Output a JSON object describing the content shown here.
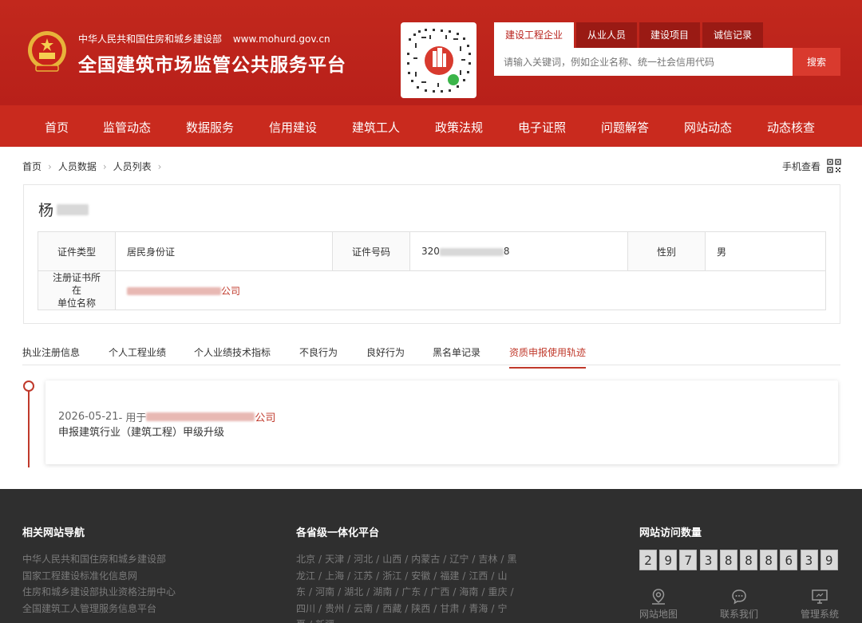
{
  "header": {
    "org": "中华人民共和国住房和城乡建设部",
    "url": "www.mohurd.gov.cn",
    "title": "全国建筑市场监管公共服务平台",
    "accent": "#b8201a"
  },
  "search": {
    "tabs": [
      "建设工程企业",
      "从业人员",
      "建设项目",
      "诚信记录"
    ],
    "active_tab": "建设工程企业",
    "placeholder": "请输入关键词，例如企业名称、统一社会信用代码",
    "button": "搜索"
  },
  "nav": [
    "首页",
    "监管动态",
    "数据服务",
    "信用建设",
    "建筑工人",
    "政策法规",
    "电子证照",
    "问题解答",
    "网站动态",
    "动态核查"
  ],
  "breadcrumb": [
    "首页",
    "人员数据",
    "人员列表"
  ],
  "mobile_view": "手机查看",
  "person": {
    "name_prefix": "杨",
    "id_type_label": "证件类型",
    "id_type": "居民身份证",
    "id_no_label": "证件号码",
    "id_no_prefix": "320",
    "id_no_suffix": "8",
    "gender_label": "性别",
    "gender": "男",
    "employer_label_1": "注册证书所在",
    "employer_label_2": "单位名称",
    "employer_suffix": "公司"
  },
  "detail_tabs": [
    "执业注册信息",
    "个人工程业绩",
    "个人业绩技术指标",
    "不良行为",
    "良好行为",
    "黑名单记录",
    "资质申报使用轨迹"
  ],
  "active_detail_tab": "资质申报使用轨迹",
  "timeline": [
    {
      "date": "2026-05-21",
      "used_for": " - 用于",
      "company_suffix": "公司",
      "description": "申报建筑行业（建筑工程）甲级升级"
    }
  ],
  "footer": {
    "links_title": "相关网站导航",
    "links": [
      "中华人民共和国住房和城乡建设部",
      "国家工程建设标准化信息网",
      "住房和城乡建设部执业资格注册中心",
      "全国建筑工人管理服务信息平台"
    ],
    "prov_title": "各省级一体化平台",
    "provinces": [
      "北京",
      "天津",
      "河北",
      "山西",
      "内蒙古",
      "辽宁",
      "吉林",
      "黑龙江",
      "上海",
      "江苏",
      "浙江",
      "安徽",
      "福建",
      "江西",
      "山东",
      "河南",
      "湖北",
      "湖南",
      "广东",
      "广西",
      "海南",
      "重庆",
      "四川",
      "贵州",
      "云南",
      "西藏",
      "陕西",
      "甘肃",
      "青海",
      "宁夏",
      "新疆"
    ],
    "visits_title": "网站访问数量",
    "visit_digits": [
      "2",
      "9",
      "7",
      "3",
      "8",
      "8",
      "8",
      "6",
      "3",
      "9"
    ],
    "icons": [
      {
        "label": "网站地图",
        "icon": "map-pin-icon"
      },
      {
        "label": "联系我们",
        "icon": "chat-bubble-icon"
      },
      {
        "label": "管理系统",
        "icon": "monitor-icon"
      }
    ]
  }
}
